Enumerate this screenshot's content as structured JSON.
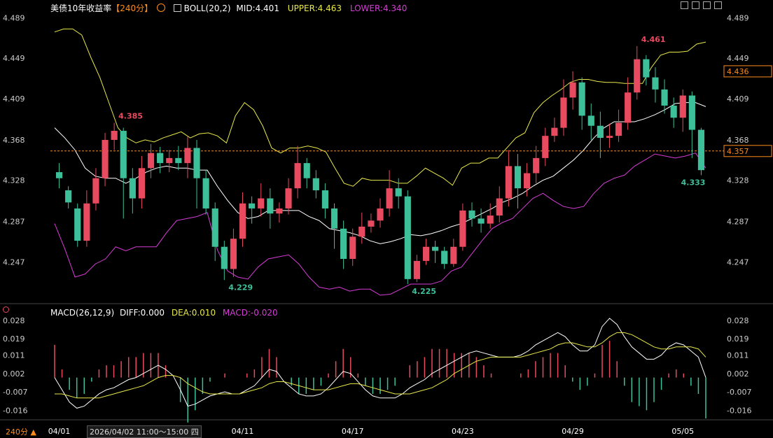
{
  "header": {
    "symbol": "美债10年收益率",
    "period": "【240分】",
    "indicator_icon": "indicator-toggle-icon",
    "boll_label": "BOLL(20,2)",
    "mid": "MID:4.401",
    "upper": "UPPER:4.463",
    "lower": "LOWER:4.340"
  },
  "macd_header": {
    "name": "MACD(26,12,9)",
    "diff": "DIFF:0.000",
    "dea": "DEA:0.010",
    "macd": "MACD:-0.020"
  },
  "footer": {
    "period_button": "240分 ▲",
    "cursor_time": "2026/04/02 11:00～15:00 四"
  },
  "colors": {
    "up": "#e84a5f",
    "down": "#3dc09a",
    "mid": "#ffffff",
    "upper": "#e8e84a",
    "lower": "#d63cd6",
    "diff": "#ffffff",
    "dea": "#e8e84a",
    "current_price_box": "#ff8c1a"
  },
  "chart_data": [
    {
      "type": "candlestick",
      "title": "美债10年收益率",
      "ylim": [
        4.207,
        4.497
      ],
      "y_ticks": [
        "4.489",
        "4.449",
        "4.409",
        "4.368",
        "4.328",
        "4.287",
        "4.247"
      ],
      "x_ticks": [
        "04/01",
        "04/11",
        "04/17",
        "04/23",
        "04/29",
        "05/05"
      ],
      "x_tick_index": [
        0,
        20,
        32,
        44,
        56,
        68
      ],
      "annotations": {
        "high1": "4.385",
        "low1": "4.229",
        "low2": "4.225",
        "high2": "4.461",
        "last_low": "4.333"
      },
      "current_price": "4.357",
      "crosshair_price": "4.436",
      "upper_band": [
        4.475,
        4.478,
        4.478,
        4.472,
        4.45,
        4.43,
        4.405,
        4.38,
        4.37,
        4.365,
        4.368,
        4.366,
        4.37,
        4.373,
        4.376,
        4.37,
        4.374,
        4.375,
        4.372,
        4.365,
        4.392,
        4.405,
        4.398,
        4.382,
        4.36,
        4.355,
        4.36,
        4.36,
        4.362,
        4.36,
        4.356,
        4.34,
        4.325,
        4.322,
        4.33,
        4.328,
        4.328,
        4.328,
        4.325,
        4.325,
        4.332,
        4.34,
        4.335,
        4.33,
        4.323,
        4.34,
        4.345,
        4.345,
        4.35,
        4.35,
        4.36,
        4.37,
        4.375,
        4.395,
        4.405,
        4.412,
        4.418,
        4.425,
        4.428,
        4.428,
        4.426,
        4.425,
        4.425,
        4.424,
        4.424,
        4.424,
        4.44,
        4.452,
        4.455,
        4.455,
        4.456,
        4.463,
        4.465
      ],
      "mid_band": [
        4.38,
        4.37,
        4.358,
        4.34,
        4.332,
        4.33,
        4.33,
        4.325,
        4.33,
        4.336,
        4.34,
        4.342,
        4.34,
        4.34,
        4.338,
        4.338,
        4.322,
        4.308,
        4.296,
        4.29,
        4.292,
        4.298,
        4.298,
        4.298,
        4.298,
        4.292,
        4.288,
        4.28,
        4.278,
        4.276,
        4.273,
        4.268,
        4.265,
        4.267,
        4.27,
        4.274,
        4.273,
        4.275,
        4.278,
        4.282,
        4.285,
        4.29,
        4.295,
        4.3,
        4.306,
        4.31,
        4.315,
        4.322,
        4.328,
        4.332,
        4.34,
        4.348,
        4.358,
        4.37,
        4.38,
        4.386,
        4.386,
        4.386,
        4.389,
        4.393,
        4.398,
        4.404,
        4.405,
        4.405,
        4.401
      ],
      "lower_band": [
        4.285,
        4.26,
        4.232,
        4.235,
        4.245,
        4.25,
        4.262,
        4.258,
        4.262,
        4.262,
        4.262,
        4.276,
        4.288,
        4.29,
        4.292,
        4.296,
        4.259,
        4.238,
        4.232,
        4.23,
        4.242,
        4.25,
        4.252,
        4.254,
        4.245,
        4.232,
        4.222,
        4.22,
        4.222,
        4.218,
        4.22,
        4.22,
        4.214,
        4.215,
        4.22,
        4.225,
        4.225,
        4.225,
        4.228,
        4.238,
        4.242,
        4.255,
        4.268,
        4.28,
        4.286,
        4.29,
        4.3,
        4.31,
        4.315,
        4.308,
        4.302,
        4.3,
        4.302,
        4.315,
        4.325,
        4.33,
        4.333,
        4.342,
        4.348,
        4.354,
        4.352,
        4.35,
        4.352,
        4.355,
        4.34
      ],
      "candles": [
        [
          4.336,
          4.33,
          4.345,
          4.32
        ],
        [
          4.318,
          4.306,
          4.322,
          4.3
        ],
        [
          4.3,
          4.268,
          4.305,
          4.262
        ],
        [
          4.268,
          4.305,
          4.318,
          4.262
        ],
        [
          4.305,
          4.33,
          4.34,
          4.298
        ],
        [
          4.33,
          4.368,
          4.375,
          4.322
        ],
        [
          4.368,
          4.377,
          4.385,
          4.358
        ],
        [
          4.377,
          4.33,
          4.38,
          4.29
        ],
        [
          4.33,
          4.31,
          4.34,
          4.295
        ],
        [
          4.31,
          4.34,
          4.352,
          4.3
        ],
        [
          4.34,
          4.355,
          4.364,
          4.33
        ],
        [
          4.355,
          4.345,
          4.361,
          4.335
        ],
        [
          4.345,
          4.35,
          4.358,
          4.336
        ],
        [
          4.35,
          4.345,
          4.362,
          4.338
        ],
        [
          4.345,
          4.36,
          4.371,
          4.33
        ],
        [
          4.36,
          4.33,
          4.368,
          4.3
        ],
        [
          4.33,
          4.3,
          4.338,
          4.294
        ],
        [
          4.3,
          4.262,
          4.306,
          4.248
        ],
        [
          4.262,
          4.24,
          4.268,
          4.229
        ],
        [
          4.24,
          4.27,
          4.28,
          4.232
        ],
        [
          4.27,
          4.305,
          4.316,
          4.262
        ],
        [
          4.305,
          4.3,
          4.312,
          4.285
        ],
        [
          4.3,
          4.31,
          4.325,
          4.292
        ],
        [
          4.31,
          4.295,
          4.32,
          4.28
        ],
        [
          4.295,
          4.3,
          4.306,
          4.286
        ],
        [
          4.3,
          4.32,
          4.33,
          4.294
        ],
        [
          4.32,
          4.345,
          4.362,
          4.31
        ],
        [
          4.345,
          4.33,
          4.35,
          4.32
        ],
        [
          4.33,
          4.318,
          4.338,
          4.31
        ],
        [
          4.318,
          4.3,
          4.325,
          4.29
        ],
        [
          4.3,
          4.28,
          4.305,
          4.26
        ],
        [
          4.28,
          4.25,
          4.288,
          4.24
        ],
        [
          4.25,
          4.272,
          4.28,
          4.243
        ],
        [
          4.272,
          4.282,
          4.296,
          4.265
        ],
        [
          4.282,
          4.288,
          4.295,
          4.276
        ],
        [
          4.288,
          4.3,
          4.31,
          4.281
        ],
        [
          4.3,
          4.32,
          4.338,
          4.292
        ],
        [
          4.32,
          4.312,
          4.33,
          4.3
        ],
        [
          4.312,
          4.23,
          4.318,
          4.225
        ],
        [
          4.23,
          4.248,
          4.254,
          4.227
        ],
        [
          4.248,
          4.262,
          4.27,
          4.244
        ],
        [
          4.262,
          4.258,
          4.268,
          4.246
        ],
        [
          4.258,
          4.245,
          4.262,
          4.24
        ],
        [
          4.245,
          4.262,
          4.27,
          4.242
        ],
        [
          4.262,
          4.298,
          4.305,
          4.258
        ],
        [
          4.298,
          4.29,
          4.306,
          4.282
        ],
        [
          4.29,
          4.285,
          4.3,
          4.276
        ],
        [
          4.285,
          4.293,
          4.305,
          4.28
        ],
        [
          4.293,
          4.31,
          4.322,
          4.286
        ],
        [
          4.31,
          4.342,
          4.358,
          4.302
        ],
        [
          4.342,
          4.32,
          4.354,
          4.3
        ],
        [
          4.32,
          4.335,
          4.345,
          4.312
        ],
        [
          4.335,
          4.35,
          4.362,
          4.325
        ],
        [
          4.35,
          4.372,
          4.38,
          4.342
        ],
        [
          4.372,
          4.38,
          4.39,
          4.366
        ],
        [
          4.38,
          4.41,
          4.428,
          4.372
        ],
        [
          4.41,
          4.425,
          4.436,
          4.398
        ],
        [
          4.425,
          4.392,
          4.43,
          4.378
        ],
        [
          4.392,
          4.382,
          4.404,
          4.368
        ],
        [
          4.382,
          4.37,
          4.396,
          4.35
        ],
        [
          4.37,
          4.372,
          4.384,
          4.36
        ],
        [
          4.372,
          4.385,
          4.398,
          4.366
        ],
        [
          4.385,
          4.415,
          4.43,
          4.378
        ],
        [
          4.415,
          4.448,
          4.461,
          4.408
        ],
        [
          4.448,
          4.43,
          4.452,
          4.422
        ],
        [
          4.43,
          4.418,
          4.44,
          4.405
        ],
        [
          4.418,
          4.402,
          4.428,
          4.394
        ],
        [
          4.402,
          4.39,
          4.41,
          4.38
        ],
        [
          4.39,
          4.412,
          4.418,
          4.376
        ],
        [
          4.412,
          4.378,
          4.416,
          4.35
        ],
        [
          4.378,
          4.338,
          4.38,
          4.333
        ]
      ]
    },
    {
      "type": "macd",
      "title": "MACD(26,12,9)",
      "ylim": [
        -0.02,
        0.03
      ],
      "y_ticks": [
        "0.028",
        "0.019",
        "0.011",
        "0.002",
        "-0.007",
        "-0.016"
      ],
      "diff": [
        0.0,
        -0.006,
        -0.012,
        -0.015,
        -0.014,
        -0.011,
        -0.008,
        -0.006,
        -0.005,
        -0.003,
        -0.001,
        0.0,
        0.002,
        0.004,
        0.006,
        0.004,
        0.001,
        -0.006,
        -0.014,
        -0.013,
        -0.011,
        -0.009,
        -0.008,
        -0.007,
        -0.008,
        -0.008,
        -0.006,
        -0.004,
        0.0,
        0.004,
        0.003,
        -0.002,
        -0.005,
        -0.008,
        -0.009,
        -0.009,
        -0.008,
        -0.005,
        -0.001,
        0.003,
        0.002,
        -0.002,
        -0.006,
        -0.009,
        -0.01,
        -0.01,
        -0.01,
        -0.008,
        -0.005,
        -0.003,
        -0.001,
        0.002,
        0.004,
        0.006,
        0.008,
        0.01,
        0.012,
        0.013,
        0.012,
        0.011,
        0.01,
        0.01,
        0.01,
        0.011,
        0.013,
        0.016,
        0.018,
        0.02,
        0.022,
        0.02,
        0.016,
        0.013,
        0.013,
        0.016,
        0.025,
        0.029,
        0.026,
        0.02,
        0.015,
        0.012,
        0.009,
        0.009,
        0.011,
        0.015,
        0.017,
        0.016,
        0.013,
        0.01,
        0.0
      ],
      "dea": [
        -0.008,
        -0.008,
        -0.009,
        -0.01,
        -0.01,
        -0.01,
        -0.01,
        -0.009,
        -0.008,
        -0.007,
        -0.006,
        -0.005,
        -0.004,
        -0.002,
        0.0,
        0.001,
        0.001,
        0.0,
        -0.003,
        -0.005,
        -0.007,
        -0.008,
        -0.008,
        -0.008,
        -0.008,
        -0.008,
        -0.007,
        -0.006,
        -0.005,
        -0.003,
        -0.002,
        -0.002,
        -0.003,
        -0.004,
        -0.005,
        -0.006,
        -0.006,
        -0.006,
        -0.005,
        -0.004,
        -0.003,
        -0.003,
        -0.004,
        -0.005,
        -0.006,
        -0.007,
        -0.008,
        -0.008,
        -0.008,
        -0.007,
        -0.006,
        -0.005,
        -0.003,
        -0.001,
        0.002,
        0.004,
        0.006,
        0.008,
        0.009,
        0.01,
        0.01,
        0.01,
        0.01,
        0.01,
        0.011,
        0.012,
        0.013,
        0.014,
        0.016,
        0.017,
        0.017,
        0.016,
        0.015,
        0.015,
        0.017,
        0.02,
        0.022,
        0.022,
        0.021,
        0.019,
        0.017,
        0.015,
        0.014,
        0.014,
        0.015,
        0.015,
        0.015,
        0.014,
        0.01
      ]
    }
  ]
}
